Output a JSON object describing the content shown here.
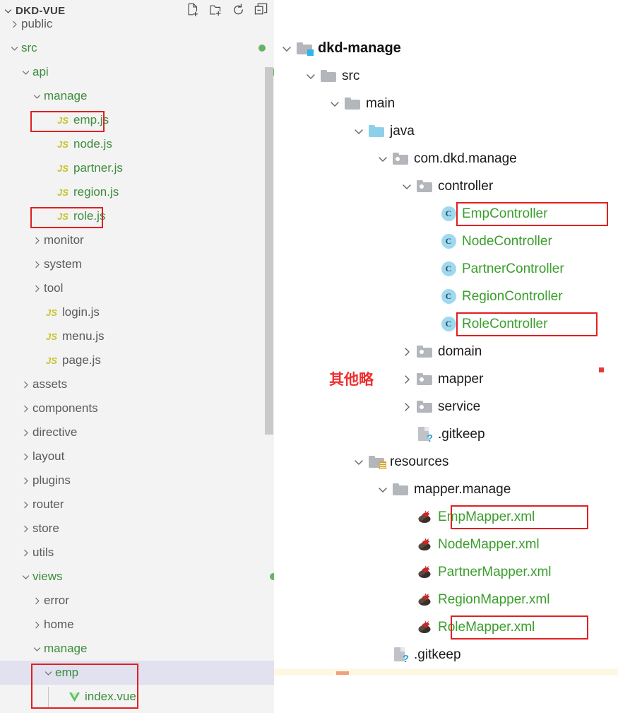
{
  "explorer": {
    "title": "DKD-VUE",
    "collapse_chevron": "chevron-down",
    "actions": [
      {
        "name": "new-file-icon",
        "label": "New File"
      },
      {
        "name": "new-folder-icon",
        "label": "New Folder"
      },
      {
        "name": "refresh-icon",
        "label": "Refresh Explorer"
      },
      {
        "name": "collapse-all-icon",
        "label": "Collapse Folders in Explorer"
      }
    ],
    "rows": [
      {
        "label": "public",
        "icon": "folder",
        "twisty": "chevron-right",
        "indent": 0,
        "color": "gray",
        "status": "",
        "partial": true
      },
      {
        "label": "src",
        "icon": "folder",
        "twisty": "chevron-down",
        "indent": 0,
        "color": "green",
        "status": "dot"
      },
      {
        "label": "api",
        "icon": "folder",
        "twisty": "chevron-down",
        "indent": 1,
        "color": "green",
        "status": "dot"
      },
      {
        "label": "manage",
        "icon": "folder",
        "twisty": "chevron-down",
        "indent": 2,
        "color": "green",
        "status": "dot"
      },
      {
        "label": "emp.js",
        "icon": "js",
        "twisty": "none",
        "indent": 3,
        "color": "green",
        "status": "U",
        "highlight": true
      },
      {
        "label": "node.js",
        "icon": "js",
        "twisty": "none",
        "indent": 3,
        "color": "green",
        "status": "U"
      },
      {
        "label": "partner.js",
        "icon": "js",
        "twisty": "none",
        "indent": 3,
        "color": "green",
        "status": "U"
      },
      {
        "label": "region.js",
        "icon": "js",
        "twisty": "none",
        "indent": 3,
        "color": "green",
        "status": "U"
      },
      {
        "label": "role.js",
        "icon": "js",
        "twisty": "none",
        "indent": 3,
        "color": "green",
        "status": "U",
        "highlight": true
      },
      {
        "label": "monitor",
        "icon": "folder",
        "twisty": "chevron-right",
        "indent": 2,
        "color": "gray",
        "status": ""
      },
      {
        "label": "system",
        "icon": "folder",
        "twisty": "chevron-right",
        "indent": 2,
        "color": "gray",
        "status": ""
      },
      {
        "label": "tool",
        "icon": "folder",
        "twisty": "chevron-right",
        "indent": 2,
        "color": "gray",
        "status": ""
      },
      {
        "label": "login.js",
        "icon": "js",
        "twisty": "none",
        "indent": 2,
        "color": "gray",
        "status": ""
      },
      {
        "label": "menu.js",
        "icon": "js",
        "twisty": "none",
        "indent": 2,
        "color": "gray",
        "status": ""
      },
      {
        "label": "page.js",
        "icon": "js",
        "twisty": "none",
        "indent": 2,
        "color": "gray",
        "status": ""
      },
      {
        "label": "assets",
        "icon": "folder",
        "twisty": "chevron-right",
        "indent": 1,
        "color": "gray",
        "status": ""
      },
      {
        "label": "components",
        "icon": "folder",
        "twisty": "chevron-right",
        "indent": 1,
        "color": "gray",
        "status": ""
      },
      {
        "label": "directive",
        "icon": "folder",
        "twisty": "chevron-right",
        "indent": 1,
        "color": "gray",
        "status": ""
      },
      {
        "label": "layout",
        "icon": "folder",
        "twisty": "chevron-right",
        "indent": 1,
        "color": "gray",
        "status": ""
      },
      {
        "label": "plugins",
        "icon": "folder",
        "twisty": "chevron-right",
        "indent": 1,
        "color": "gray",
        "status": ""
      },
      {
        "label": "router",
        "icon": "folder",
        "twisty": "chevron-right",
        "indent": 1,
        "color": "gray",
        "status": ""
      },
      {
        "label": "store",
        "icon": "folder",
        "twisty": "chevron-right",
        "indent": 1,
        "color": "gray",
        "status": ""
      },
      {
        "label": "utils",
        "icon": "folder",
        "twisty": "chevron-right",
        "indent": 1,
        "color": "gray",
        "status": ""
      },
      {
        "label": "views",
        "icon": "folder",
        "twisty": "chevron-down",
        "indent": 1,
        "color": "green",
        "status": "dot"
      },
      {
        "label": "error",
        "icon": "folder",
        "twisty": "chevron-right",
        "indent": 2,
        "color": "gray",
        "status": ""
      },
      {
        "label": "home",
        "icon": "folder",
        "twisty": "chevron-right",
        "indent": 2,
        "color": "gray",
        "status": ""
      },
      {
        "label": "manage",
        "icon": "folder",
        "twisty": "chevron-down",
        "indent": 2,
        "color": "green",
        "status": "dot"
      },
      {
        "label": "emp",
        "icon": "folder",
        "twisty": "chevron-down",
        "indent": 3,
        "color": "green",
        "status": "dot",
        "selected": true,
        "highlight": true
      },
      {
        "label": "index.vue",
        "icon": "vue",
        "twisty": "none",
        "indent": 4,
        "color": "green",
        "status": "U",
        "highlight": true
      }
    ]
  },
  "project": {
    "rows": [
      {
        "label": "dkd-manage",
        "icon": "folder-module",
        "twisty": "chevron-down",
        "indent": 0,
        "color": "root"
      },
      {
        "label": "src",
        "icon": "folder",
        "twisty": "chevron-down",
        "indent": 1,
        "color": "dark"
      },
      {
        "label": "main",
        "icon": "folder",
        "twisty": "chevron-down",
        "indent": 2,
        "color": "dark"
      },
      {
        "label": "java",
        "icon": "folder-source",
        "twisty": "chevron-down",
        "indent": 3,
        "color": "dark"
      },
      {
        "label": "com.dkd.manage",
        "icon": "folder-package",
        "twisty": "chevron-down",
        "indent": 4,
        "color": "dark"
      },
      {
        "label": "controller",
        "icon": "folder-package",
        "twisty": "chevron-down",
        "indent": 5,
        "color": "dark"
      },
      {
        "label": "EmpController",
        "icon": "java-class",
        "twisty": "none",
        "indent": 6,
        "color": "green",
        "highlight": true
      },
      {
        "label": "NodeController",
        "icon": "java-class",
        "twisty": "none",
        "indent": 6,
        "color": "green"
      },
      {
        "label": "PartnerController",
        "icon": "java-class",
        "twisty": "none",
        "indent": 6,
        "color": "green"
      },
      {
        "label": "RegionController",
        "icon": "java-class",
        "twisty": "none",
        "indent": 6,
        "color": "green"
      },
      {
        "label": "RoleController",
        "icon": "java-class",
        "twisty": "none",
        "indent": 6,
        "color": "green",
        "highlight": true
      },
      {
        "label": "domain",
        "icon": "folder-package",
        "twisty": "chevron-right",
        "indent": 5,
        "color": "dark"
      },
      {
        "label": "mapper",
        "icon": "folder-package",
        "twisty": "chevron-right",
        "indent": 5,
        "color": "dark"
      },
      {
        "label": "service",
        "icon": "folder-package",
        "twisty": "chevron-right",
        "indent": 5,
        "color": "dark"
      },
      {
        "label": ".gitkeep",
        "icon": "gitkeep-file",
        "twisty": "none",
        "indent": 5,
        "color": "dark"
      },
      {
        "label": "resources",
        "icon": "folder-resources",
        "twisty": "chevron-down",
        "indent": 3,
        "color": "dark"
      },
      {
        "label": "mapper.manage",
        "icon": "folder",
        "twisty": "chevron-down",
        "indent": 4,
        "color": "dark"
      },
      {
        "label": "EmpMapper.xml",
        "icon": "mybatis-file",
        "twisty": "none",
        "indent": 5,
        "color": "green",
        "highlight": true
      },
      {
        "label": "NodeMapper.xml",
        "icon": "mybatis-file",
        "twisty": "none",
        "indent": 5,
        "color": "green"
      },
      {
        "label": "PartnerMapper.xml",
        "icon": "mybatis-file",
        "twisty": "none",
        "indent": 5,
        "color": "green"
      },
      {
        "label": "RegionMapper.xml",
        "icon": "mybatis-file",
        "twisty": "none",
        "indent": 5,
        "color": "green"
      },
      {
        "label": "RoleMapper.xml",
        "icon": "mybatis-file",
        "twisty": "none",
        "indent": 5,
        "color": "green",
        "highlight": true
      },
      {
        "label": ".gitkeep",
        "icon": "gitkeep-file",
        "twisty": "none",
        "indent": 4,
        "color": "dark"
      }
    ],
    "annotation": "其他略"
  },
  "colors": {
    "highlight_box": "#e02020",
    "annotation_red": "#ef2f2f",
    "git_green": "#3d8b3d",
    "idea_green": "#3a9e2c",
    "selection": "#e1e1f0",
    "panel_bg": "#f3f3f3",
    "source_folder_blue": "#8dd0ea",
    "module_badge_blue": "#29b6e8"
  }
}
